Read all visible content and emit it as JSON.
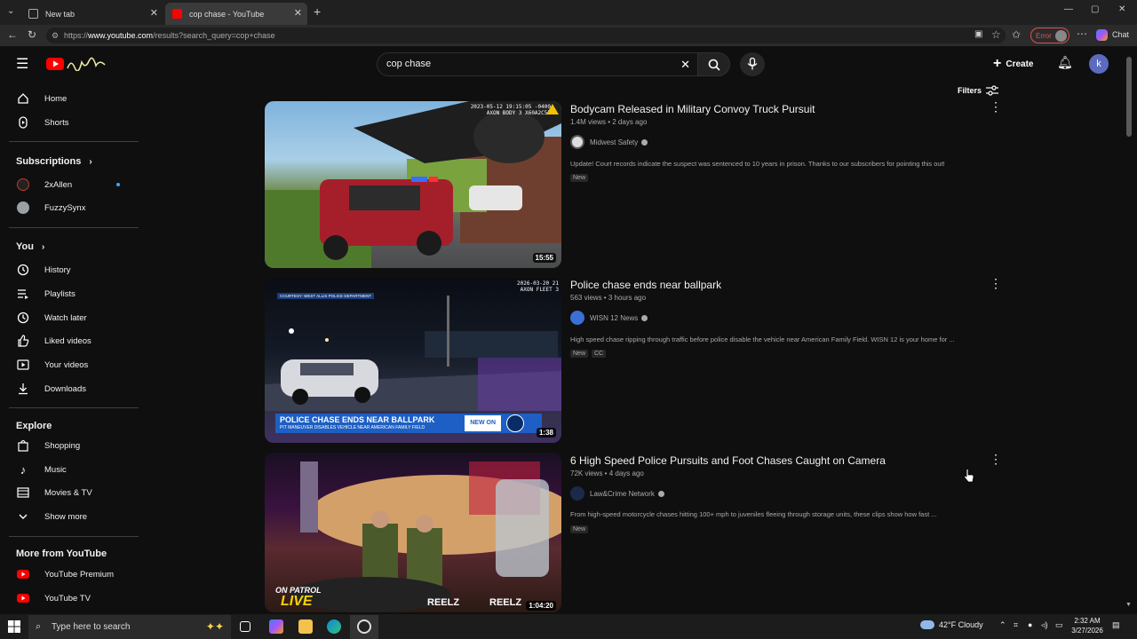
{
  "browser": {
    "tabs": [
      {
        "title": "New tab"
      },
      {
        "title": "cop chase - YouTube"
      }
    ],
    "url_prefix": "https://",
    "url_host": "www.youtube.com",
    "url_path": "/results?search_query=cop+chase",
    "error_label": "Error",
    "chat_label": "Chat"
  },
  "header": {
    "search_value": "cop chase",
    "create_label": "Create",
    "avatar_letter": "k",
    "filters_label": "Filters"
  },
  "sidebar": {
    "main": [
      {
        "label": "Home",
        "icon": "home-icon"
      },
      {
        "label": "Shorts",
        "icon": "shorts-icon"
      }
    ],
    "subscriptions_title": "Subscriptions",
    "subscriptions": [
      {
        "label": "2xAllen"
      },
      {
        "label": "FuzzySynx"
      }
    ],
    "you_title": "You",
    "you": [
      {
        "label": "History",
        "icon": "history-icon"
      },
      {
        "label": "Playlists",
        "icon": "playlists-icon"
      },
      {
        "label": "Watch later",
        "icon": "clock-icon"
      },
      {
        "label": "Liked videos",
        "icon": "thumbs-up-icon"
      },
      {
        "label": "Your videos",
        "icon": "play-icon"
      },
      {
        "label": "Downloads",
        "icon": "download-icon"
      }
    ],
    "explore_title": "Explore",
    "explore": [
      {
        "label": "Shopping",
        "icon": "shopping-bag-icon"
      },
      {
        "label": "Music",
        "icon": "music-note-icon"
      },
      {
        "label": "Movies & TV",
        "icon": "film-icon"
      },
      {
        "label": "Show more",
        "icon": "chevron-down-icon"
      }
    ],
    "more_title": "More from YouTube",
    "more": [
      {
        "label": "YouTube Premium"
      },
      {
        "label": "YouTube TV"
      }
    ]
  },
  "results": [
    {
      "title": "Bodycam Released in Military Convoy Truck Pursuit",
      "meta": "1.4M views • 2 days ago",
      "channel": "Midwest Safety",
      "description": "Update! Court records indicate the suspect was sentenced to 10 years in prison. Thanks to our subscribers for pointing this out!",
      "badges": [
        "New"
      ],
      "duration": "15:55",
      "overlay": "2023-05-12 19:15:05 -0400 AXON BODY 3 X60A2C55"
    },
    {
      "title": "Police chase ends near ballpark",
      "meta": "563 views • 3 hours ago",
      "channel": "WISN 12 News",
      "description": "High speed chase ripping through traffic before police disable the vehicle near American Family Field. WISN 12 is your home for ...",
      "badges": [
        "New",
        "CC"
      ],
      "duration": "1:38",
      "overlay": "2026-03-20 21 AXON FLEET 3",
      "lower_third": "POLICE CHASE ENDS NEAR BALLPARK",
      "lower_sub": "PIT MANEUVER DISABLES VEHICLE NEAR AMERICAN FAMILY FIELD",
      "lower_tag": "NEW ON",
      "courtesy": "COURTESY: WEST ALLIS POLICE DEPARTMENT"
    },
    {
      "title": "6 High Speed Police Pursuits and Foot Chases Caught on Camera",
      "meta": "72K views • 4 days ago",
      "channel": "Law&Crime Network",
      "description": "From high-speed motorcycle chases hitting 100+ mph to juveniles fleeing through storage units, these clips show how fast ...",
      "badges": [
        "New"
      ],
      "duration": "1:04:20",
      "overlay_top": "ON PATROL",
      "overlay_live": "LIVE",
      "brand": "REELZ"
    }
  ],
  "taskbar": {
    "search_placeholder": "Type here to search",
    "weather": "42°F  Cloudy",
    "time": "2:32 AM",
    "date": "3/27/2026"
  }
}
